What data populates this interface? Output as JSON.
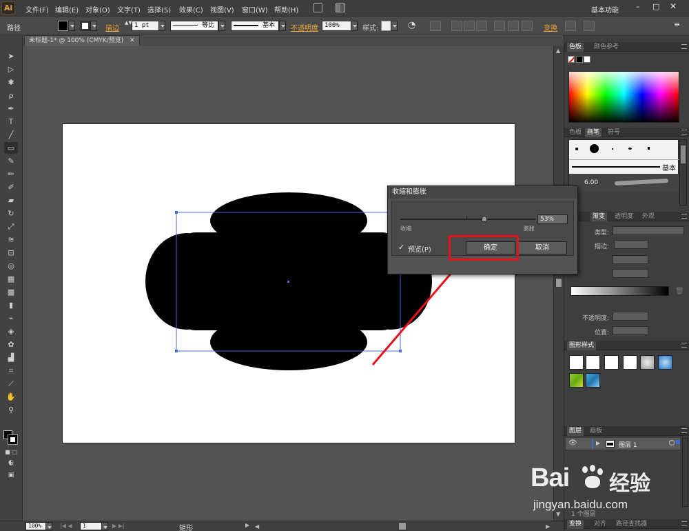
{
  "app": {
    "logo": "Ai",
    "workspace": "基本功能"
  },
  "menu": [
    "文件(F)",
    "编辑(E)",
    "对象(O)",
    "文字(T)",
    "选择(S)",
    "效果(C)",
    "视图(V)",
    "窗口(W)",
    "帮助(H)"
  ],
  "control": {
    "object_label": "路径",
    "stroke_label": "描边",
    "stroke_weight": "1 pt",
    "profile_label": "等比",
    "brush_label": "基本",
    "opacity_label": "不透明度",
    "opacity_value": "100%",
    "style_label": "样式:",
    "transform_label": "变换"
  },
  "document": {
    "tab_title": "未标题-1* @ 100% (CMYK/预览)"
  },
  "statusbar": {
    "zoom": "100%",
    "artboard": "1",
    "tool_name": "矩形"
  },
  "dialog": {
    "title": "收缩和膨胀",
    "value": "53%",
    "shrink_label": "收缩",
    "expand_label": "膨胀",
    "preview_label": "预览(P)",
    "preview_checked": true,
    "ok_label": "确定",
    "cancel_label": "取消"
  },
  "panels": {
    "color": {
      "tabs": [
        "色板",
        "颜色参考"
      ]
    },
    "brushes": {
      "tabs": [
        "色板",
        "画笔",
        "符号"
      ],
      "basic_label": "基本",
      "size_label": "6.00"
    },
    "gradient": {
      "tabs": [
        "渐变",
        "透明度",
        "外观"
      ],
      "type_label": "类型:",
      "stroke_label": "描边:",
      "opacity_label": "不透明度:",
      "position_label": "位置:"
    },
    "graphic_styles": {
      "title": "图形样式"
    },
    "layers": {
      "tabs": [
        "图层",
        "画板"
      ],
      "layer_name": "图层 1",
      "footer": "1 个图层"
    },
    "bottom": {
      "tabs": [
        "变换",
        "对齐",
        "路径查找器"
      ]
    }
  },
  "watermark": {
    "brand_a": "Bai",
    "brand_b": "经验",
    "url": "jingyan.baidu.com"
  },
  "colors": {
    "accent": "#e9a43a",
    "selection": "#4a6cd4",
    "annotation": "#e3121b"
  }
}
